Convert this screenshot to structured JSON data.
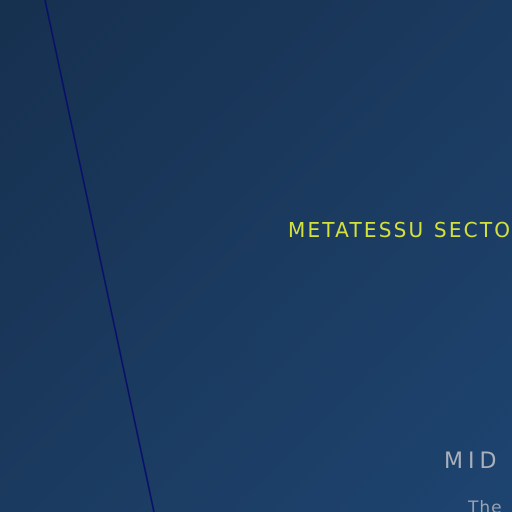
{
  "hero": {
    "sector_label": "METATESSU SECTO"
  },
  "section": {
    "heading": "MID",
    "body_snippet": "The"
  },
  "colors": {
    "background_start": "#16304f",
    "background_end": "#1d4470",
    "accent": "#d4e03c",
    "heading": "#a9b0bc",
    "divider_line": "#0a0f6a"
  }
}
